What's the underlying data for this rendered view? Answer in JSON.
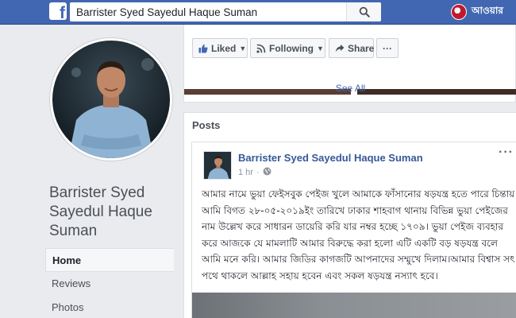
{
  "topbar": {
    "logo": "f",
    "search_value": "Barrister Syed Sayedul Haque Suman",
    "search_icon": "search-icon",
    "user_name": "আওয়ার"
  },
  "profile": {
    "name": "Barrister Syed Sayedul Haque Suman"
  },
  "nav": {
    "items": [
      {
        "label": "Home",
        "active": true
      },
      {
        "label": "Reviews",
        "active": false
      },
      {
        "label": "Photos",
        "active": false
      }
    ]
  },
  "actions": {
    "liked": "Liked",
    "following": "Following",
    "share": "Share",
    "more": "···",
    "see_all": "See All"
  },
  "posts": {
    "title": "Posts",
    "post": {
      "author": "Barrister Syed Sayedul Haque Suman",
      "time": "1 hr",
      "separator": "·",
      "more": "···",
      "text": "আমার নামে ভুয়া ফেইসবুক পেইজ খুলে আমাকে ফাঁসানোর ষড়যন্ত্র হতে পারে চিন্তায় আমি বিগত ২৮-০৫-২০১৯ইং তারিখে ঢাকার শাহবাগ থানায় বিভিন্ন ভুয়া পেইজের নাম উল্লেখ করে সাধারন ডায়েরি করি যার নম্বর হচ্ছে ১৭০৯। ভুয়া পেইজ ব্যবহার করে আজকে যে মামলাটি আমার বিরুদ্ধে করা হলো এটি একটি বড় ষড়যন্ত্র বলে আমি মনে করি। আমার জিডির কাগজটি আপনাদের সম্মুখে দিলাম।আমার বিশ্বাস সৎ পথে থাকলে আল্লাহ সহায় হবেন এবং সকল ষড়যন্ত্র নস্যাৎ হবে।"
    }
  },
  "colors": {
    "brand": "#4267b2",
    "link": "#365899",
    "background": "#e9ebee"
  }
}
